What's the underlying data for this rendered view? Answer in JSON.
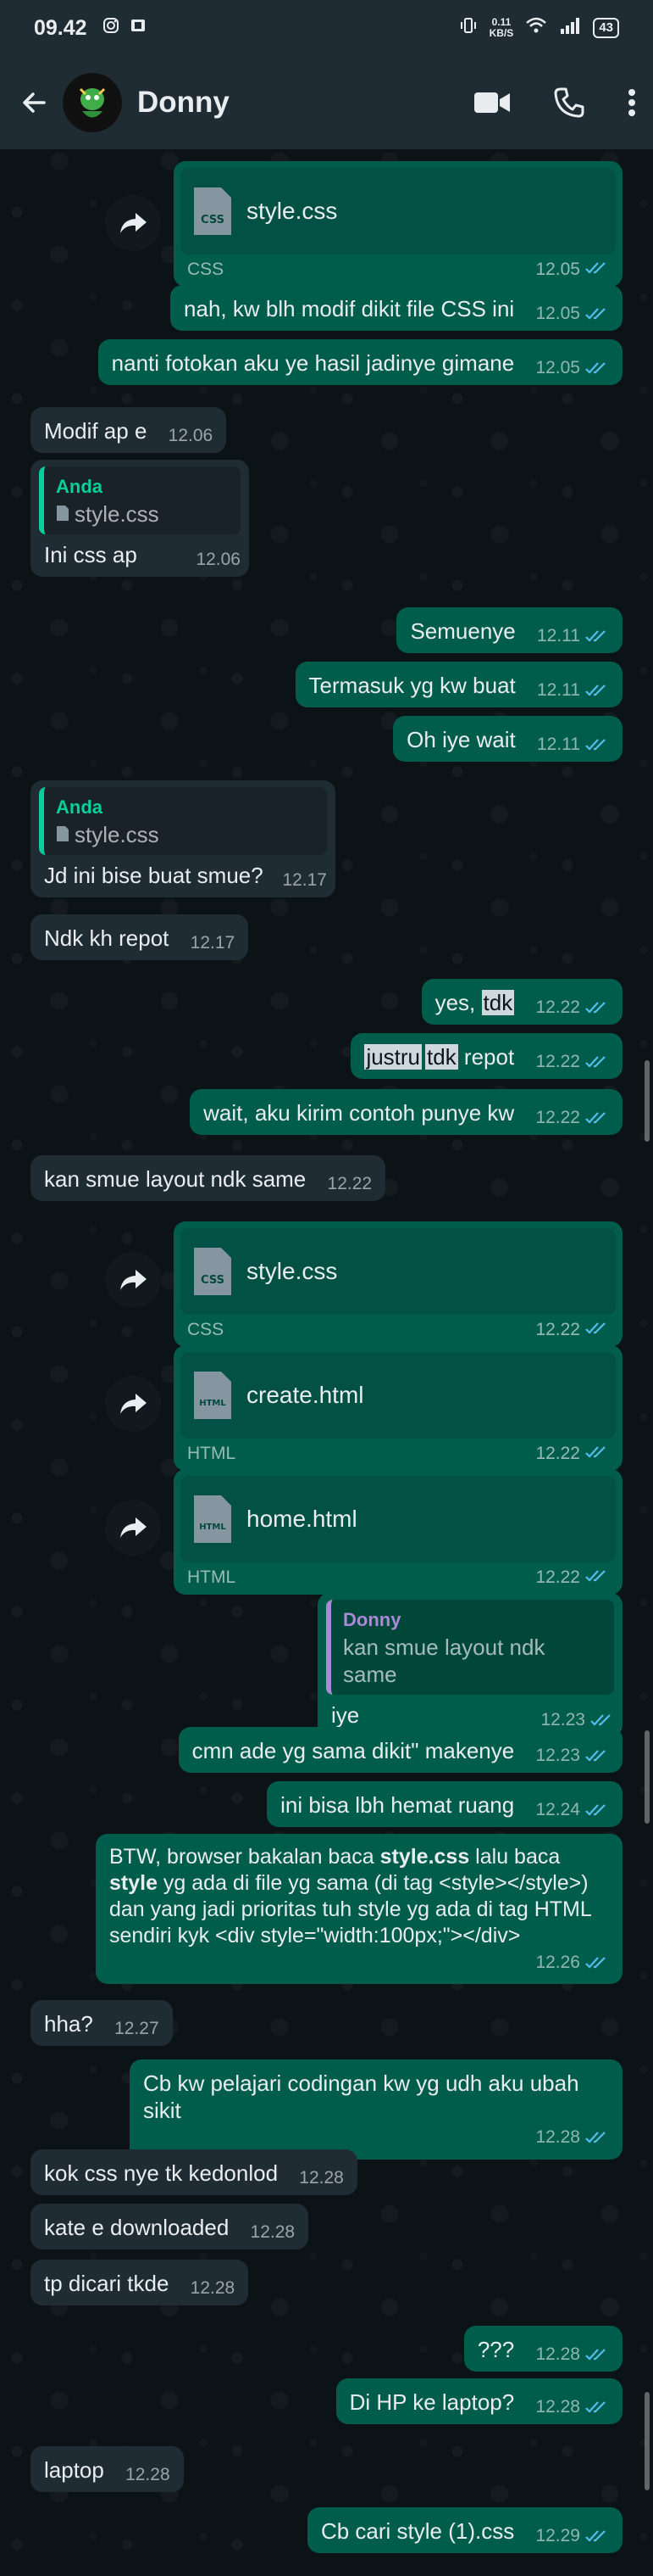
{
  "status_bar": {
    "time": "09.42",
    "net_speed_value": "0.11",
    "net_speed_unit": "KB/S",
    "battery": "43"
  },
  "header": {
    "contact_name": "Donny",
    "back_icon": "arrow-left-icon",
    "video_icon": "video-camera-icon",
    "call_icon": "phone-icon",
    "menu_icon": "more-vertical-icon"
  },
  "colors": {
    "outgoing_bubble": "#005c4b",
    "incoming_bubble": "#1f2c34",
    "read_tick": "#53bdeb",
    "quote_you": "#06cf9c",
    "quote_contact": "#a98ad6"
  },
  "messages": {
    "m1": {
      "file_name": "style.css",
      "file_type": "CSS",
      "time": "12.05"
    },
    "m2": {
      "text": "nah, kw blh modif dikit file CSS ini",
      "time": "12.05"
    },
    "m3": {
      "text": "nanti fotokan aku ye hasil jadinye gimane",
      "time": "12.05"
    },
    "m4": {
      "text": "Modif ap e",
      "time": "12.06"
    },
    "m5": {
      "quote_name": "Anda",
      "quote_text": "style.css",
      "text": "Ini css ap",
      "time": "12.06"
    },
    "m6": {
      "text": "Semuenye",
      "time": "12.11"
    },
    "m7": {
      "text": "Termasuk yg kw buat",
      "time": "12.11"
    },
    "m8": {
      "text": "Oh iye wait",
      "time": "12.11"
    },
    "m9": {
      "quote_name": "Anda",
      "quote_text": "style.css",
      "text": "Jd ini bise buat smue?",
      "time": "12.17"
    },
    "m10": {
      "text": "Ndk kh repot",
      "time": "12.17"
    },
    "m11": {
      "text_a": "yes, ",
      "text_b": "tdk",
      "time": "12.22"
    },
    "m12": {
      "text_a": "justru",
      "text_b": "tdk",
      "text_c": " repot",
      "time": "12.22"
    },
    "m13": {
      "text": "wait, aku kirim contoh punye kw",
      "time": "12.22"
    },
    "m14": {
      "text": "kan smue layout ndk same",
      "time": "12.22"
    },
    "m15": {
      "file_name": "style.css",
      "file_type": "CSS",
      "time": "12.22"
    },
    "m16": {
      "file_name": "create.html",
      "file_type": "HTML",
      "time": "12.22"
    },
    "m17": {
      "file_name": "home.html",
      "file_type": "HTML",
      "time": "12.22"
    },
    "m18": {
      "quote_name": "Donny",
      "quote_text": "kan smue layout ndk same",
      "text": "iye",
      "time": "12.23"
    },
    "m19": {
      "text": "cmn ade yg sama dikit\" makenye",
      "time": "12.23"
    },
    "m20": {
      "text": "ini bisa lbh hemat ruang",
      "time": "12.24"
    },
    "m21": {
      "p1": "BTW, browser bakalan baca ",
      "b1": "style.css",
      "p2": " lalu baca",
      "b2": "style",
      "p3": " yg ada di file yg sama (di tag <style></style>)",
      "p4": "dan yang jadi prioritas tuh style yg ada di tag HTML",
      "p5": "sendiri kyk <div style=\"width:100px;\"></div>",
      "time": "12.26"
    },
    "m22": {
      "text": "hha?",
      "time": "12.27"
    },
    "m23": {
      "text": "Cb kw pelajari codingan kw yg udh aku ubah sikit",
      "time": "12.28"
    },
    "m24": {
      "text": "kok css nye tk kedonlod",
      "time": "12.28"
    },
    "m25": {
      "text": "kate e downloaded",
      "time": "12.28"
    },
    "m26": {
      "text": "tp dicari tkde",
      "time": "12.28"
    },
    "m27": {
      "text": "???",
      "time": "12.28"
    },
    "m28": {
      "text": "Di HP ke laptop?",
      "time": "12.28"
    },
    "m29": {
      "text": "laptop",
      "time": "12.28"
    },
    "m30": {
      "text": "Cb cari style (1).css",
      "time": "12.29"
    }
  }
}
